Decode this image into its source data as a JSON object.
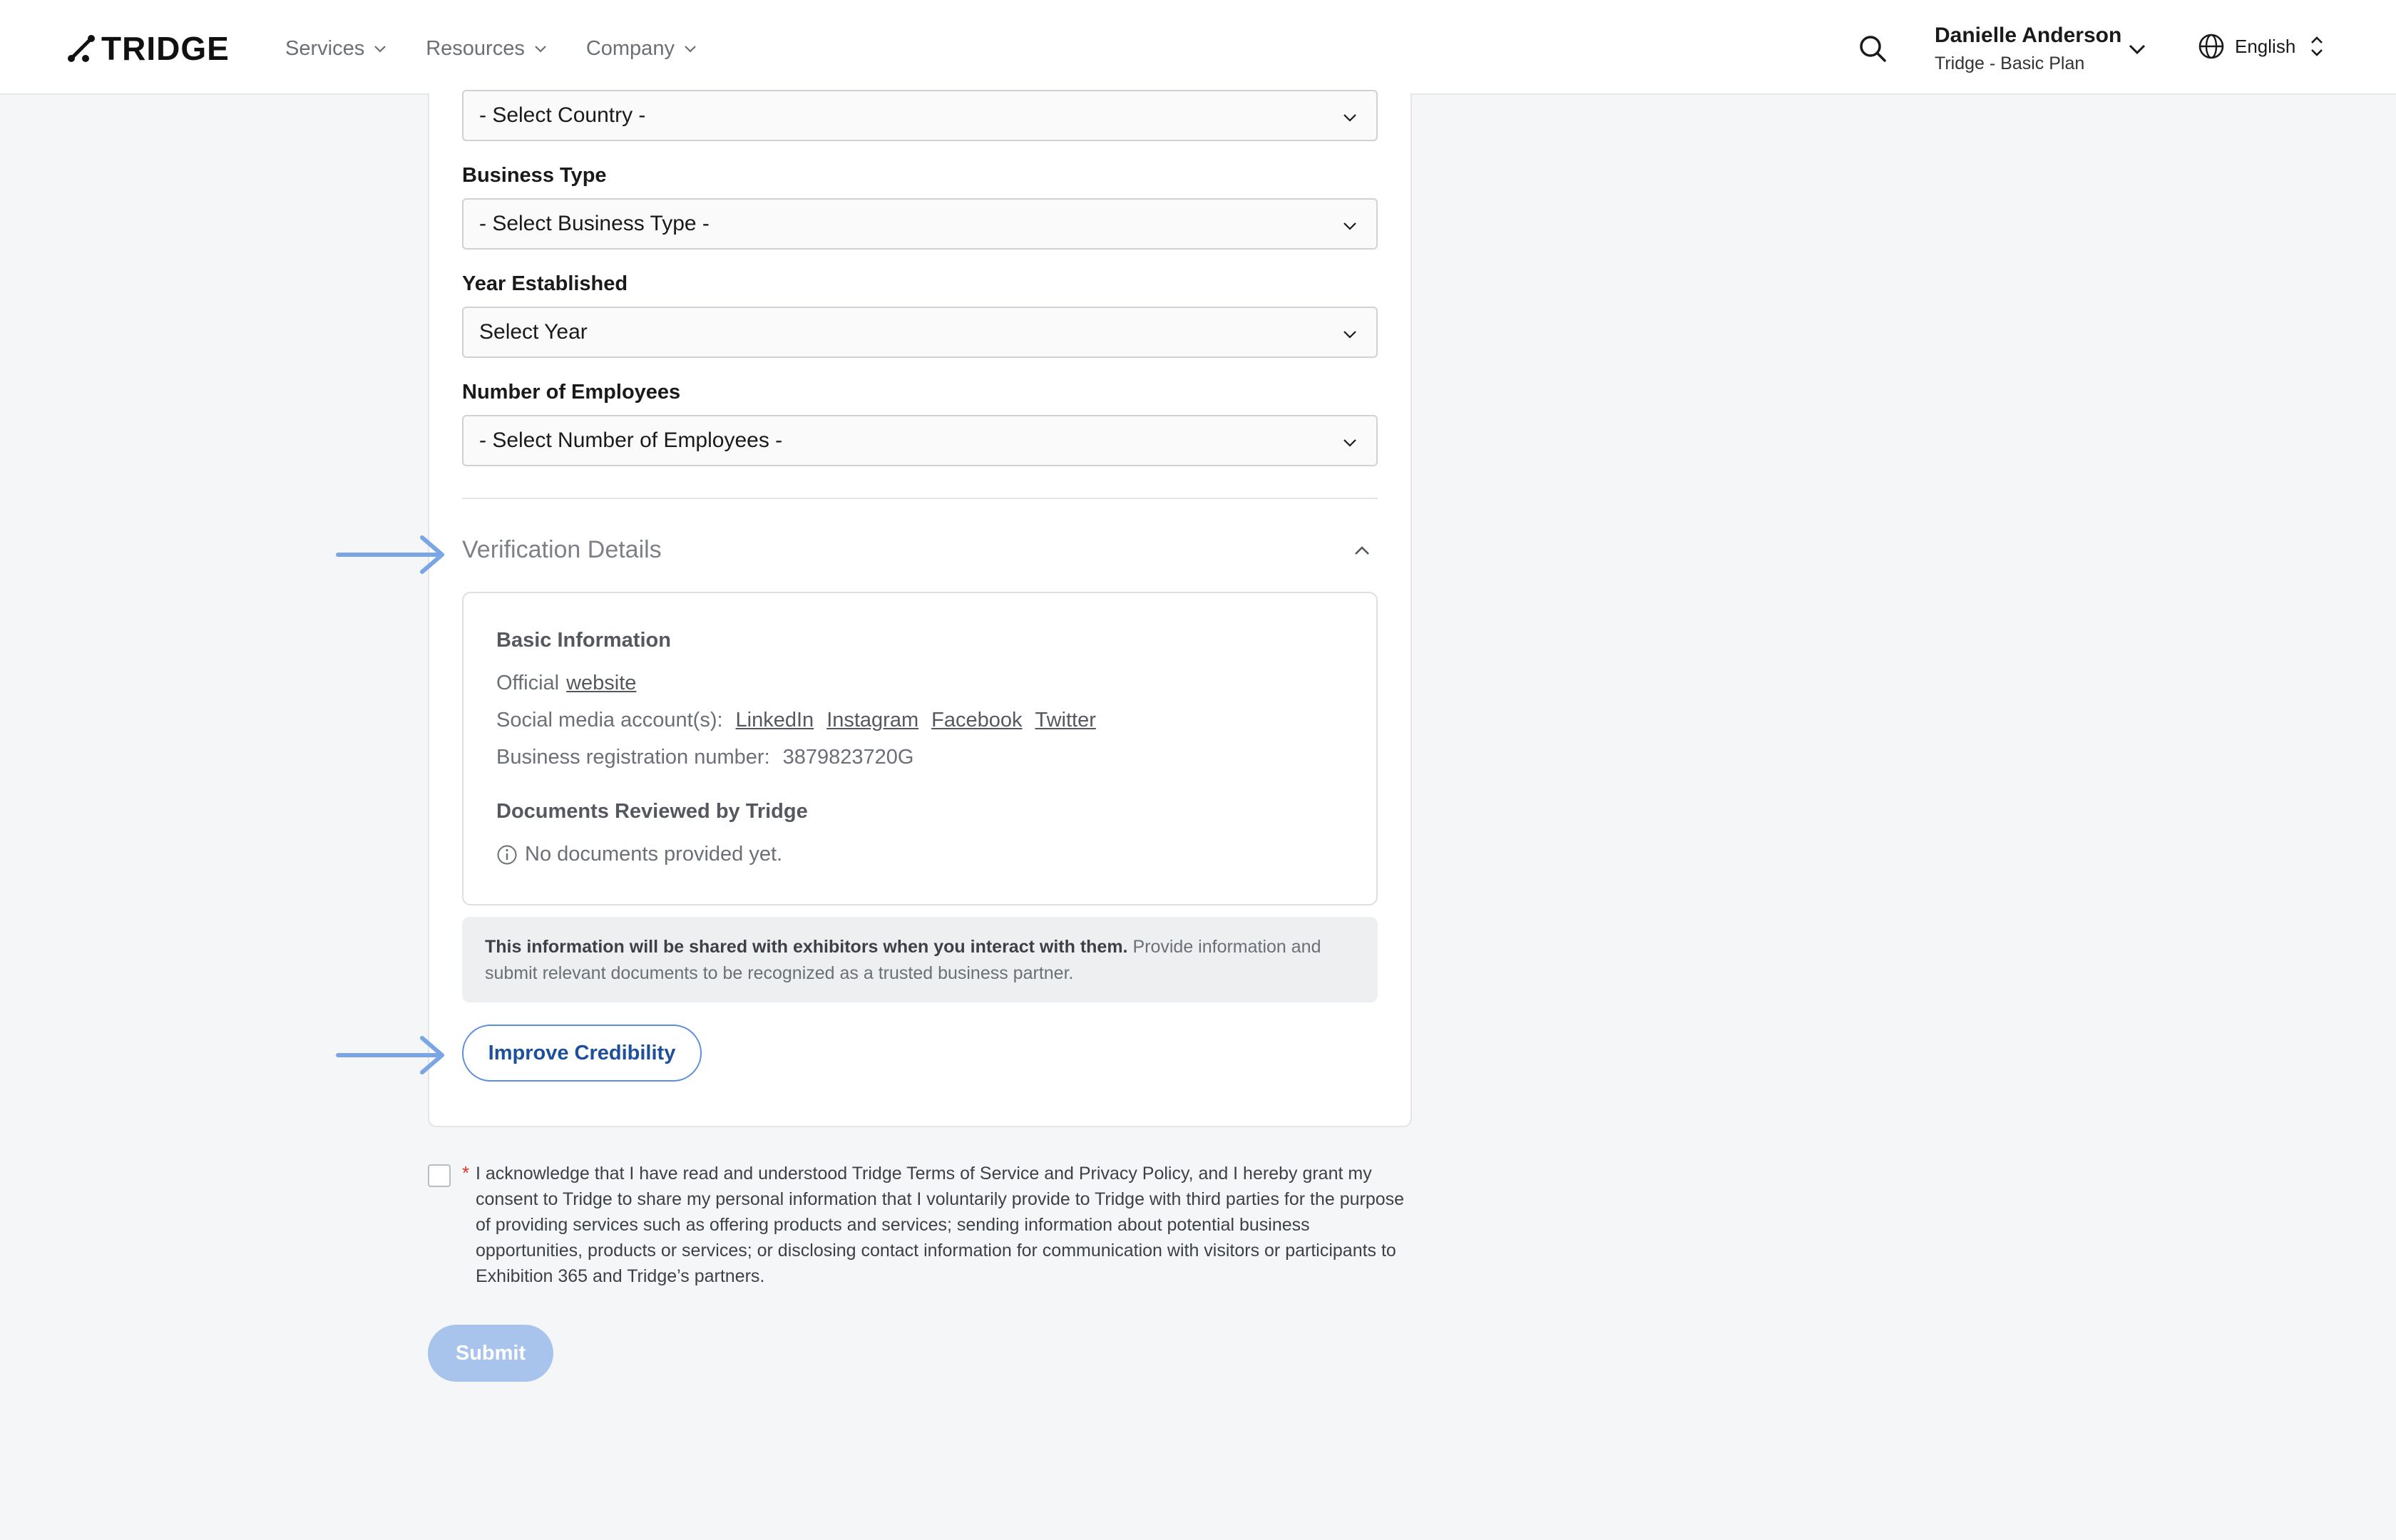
{
  "header": {
    "logo_text": "TRIDGE",
    "nav": [
      {
        "label": "Services"
      },
      {
        "label": "Resources"
      },
      {
        "label": "Company"
      }
    ],
    "user": {
      "name": "Danielle Anderson",
      "plan": "Tridge - Basic Plan"
    },
    "language": "English"
  },
  "form": {
    "country_select": "- Select Country -",
    "business_type": {
      "label": "Business Type",
      "value": "- Select Business Type -"
    },
    "year_established": {
      "label": "Year Established",
      "value": "Select Year"
    },
    "employees": {
      "label": "Number of Employees",
      "value": "- Select Number of Employees -"
    }
  },
  "verification": {
    "title": "Verification Details",
    "basic_info_heading": "Basic Information",
    "official_prefix": "Official",
    "official_link": "website",
    "social_label": "Social media account(s):",
    "social_links": [
      "LinkedIn",
      "Instagram",
      "Facebook",
      "Twitter"
    ],
    "registration_label": "Business registration number:",
    "registration_value": "3879823720G",
    "documents_heading": "Documents Reviewed by Tridge",
    "documents_empty": "No documents provided yet."
  },
  "notice": {
    "bold": "This information will be shared with exhibitors when you interact with them.",
    "rest": "Provide information and submit relevant documents to be recognized as a trusted business partner."
  },
  "improve_button": "Improve Credibility",
  "consent": {
    "required_mark": "*",
    "text": "I acknowledge that I have read and understood Tridge Terms of Service and Privacy Policy, and I hereby grant my consent to Tridge to share my personal information that I voluntarily provide to Tridge with third parties for the purpose of providing services such as offering products and services; sending information about potential business opportunities, products or services; or disclosing contact information for communication with visitors or participants to Exhibition 365 and Tridge’s partners."
  },
  "submit_button": "Submit",
  "colors": {
    "accent": "#1c4f9c",
    "annotation_arrow": "#7aa6e6",
    "submit_disabled": "#a9c4ec",
    "required": "#e0322b"
  }
}
